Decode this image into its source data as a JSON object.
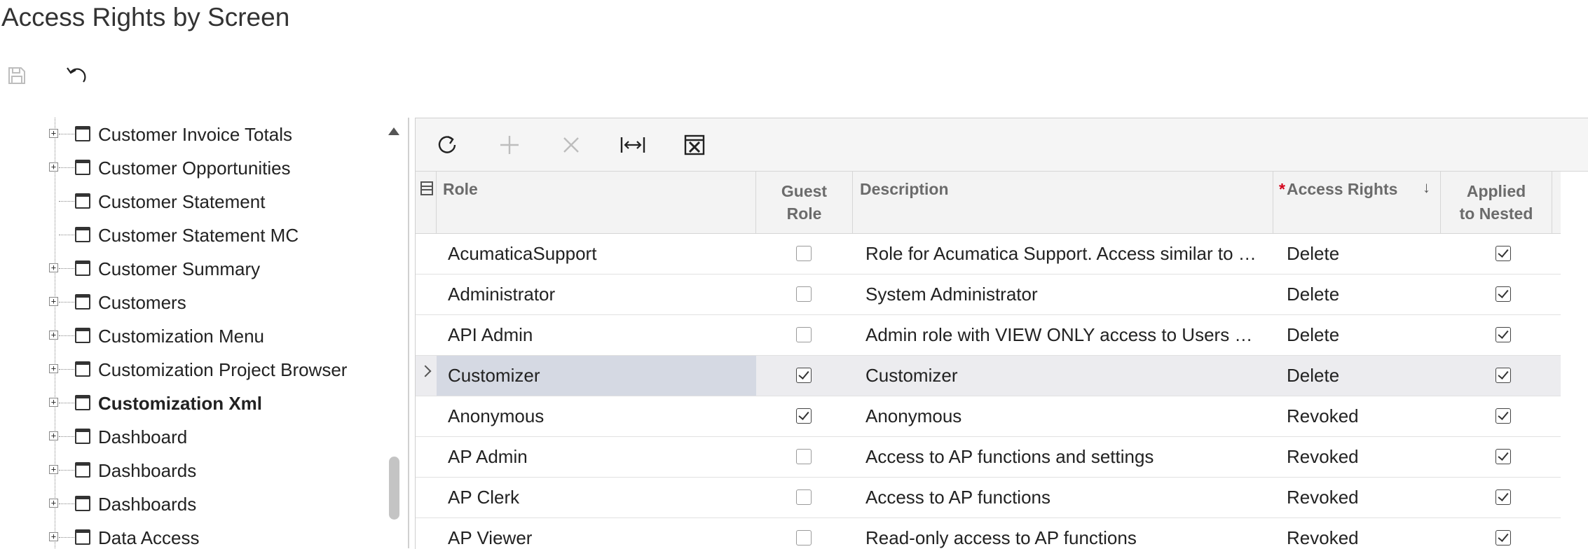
{
  "page": {
    "title": "Access Rights by Screen"
  },
  "toolbar": {
    "save_icon": "save-icon",
    "undo_icon": "undo-icon"
  },
  "tree": {
    "items": [
      {
        "label": "Customer Invoice Totals",
        "expandable": true,
        "bold": false
      },
      {
        "label": "Customer Opportunities",
        "expandable": true,
        "bold": false
      },
      {
        "label": "Customer Statement",
        "expandable": false,
        "bold": false
      },
      {
        "label": "Customer Statement MC",
        "expandable": false,
        "bold": false
      },
      {
        "label": "Customer Summary",
        "expandable": true,
        "bold": false
      },
      {
        "label": "Customers",
        "expandable": true,
        "bold": false
      },
      {
        "label": "Customization Menu",
        "expandable": true,
        "bold": false
      },
      {
        "label": "Customization Project Browser",
        "expandable": true,
        "bold": false
      },
      {
        "label": "Customization Xml",
        "expandable": true,
        "bold": true
      },
      {
        "label": "Dashboard",
        "expandable": true,
        "bold": false
      },
      {
        "label": "Dashboards",
        "expandable": true,
        "bold": false
      },
      {
        "label": "Dashboards",
        "expandable": true,
        "bold": false
      },
      {
        "label": "Data Access",
        "expandable": true,
        "bold": false
      }
    ]
  },
  "grid": {
    "toolbar_icons": [
      "refresh-icon",
      "add-icon",
      "delete-icon",
      "fit-columns-icon",
      "export-excel-icon"
    ],
    "columns": {
      "role": "Role",
      "guest_role_line1": "Guest",
      "guest_role_line2": "Role",
      "description": "Description",
      "access_rights_required": "*",
      "access_rights": "Access Rights",
      "sort_indicator": "↓",
      "applied_line1": "Applied",
      "applied_line2": "to Nested"
    },
    "rows": [
      {
        "role": "AcumaticaSupport",
        "guest": false,
        "description": "Role for Acumatica Support. Access similar to …",
        "access": "Delete",
        "applied": true
      },
      {
        "role": "Administrator",
        "guest": false,
        "description": "System Administrator",
        "access": "Delete",
        "applied": true
      },
      {
        "role": "API Admin",
        "guest": false,
        "description": "Admin role with VIEW ONLY access to Users …",
        "access": "Delete",
        "applied": true
      },
      {
        "role": "Customizer",
        "guest": true,
        "description": "Customizer",
        "access": "Delete",
        "applied": true,
        "selected": true
      },
      {
        "role": "Anonymous",
        "guest": true,
        "description": "Anonymous",
        "access": "Revoked",
        "applied": true
      },
      {
        "role": "AP Admin",
        "guest": false,
        "description": "Access to AP functions and settings",
        "access": "Revoked",
        "applied": true
      },
      {
        "role": "AP Clerk",
        "guest": false,
        "description": "Access to AP functions",
        "access": "Revoked",
        "applied": true
      },
      {
        "role": "AP Viewer",
        "guest": false,
        "description": "Read-only access to AP functions",
        "access": "Revoked",
        "applied": true
      }
    ]
  }
}
